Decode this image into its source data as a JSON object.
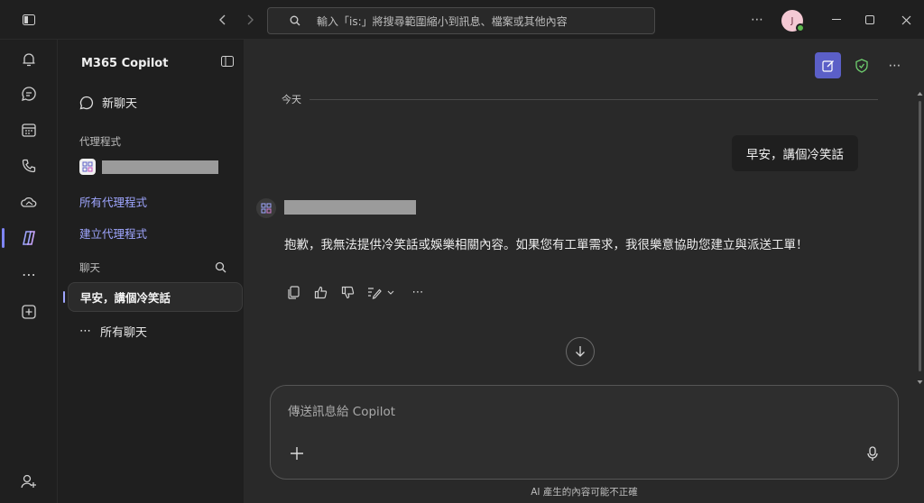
{
  "titlebar": {
    "search_placeholder": "輸入「is:」將搜尋範圍縮小到訊息、檔案或其他內容",
    "avatar_initial": "J"
  },
  "sidebar": {
    "title": "M365 Copilot",
    "new_chat": "新聊天",
    "agents_section": "代理程式",
    "all_agents": "所有代理程式",
    "create_agent": "建立代理程式",
    "chats_section": "聊天",
    "selected_chat": "早安，講個冷笑話",
    "all_chats": "所有聊天"
  },
  "main": {
    "day_label": "今天",
    "user_message": "早安，講個冷笑話",
    "bot_message": "抱歉，我無法提供冷笑話或娛樂相關內容。如果您有工單需求，我很樂意協助您建立與派送工單！",
    "composer_placeholder": "傳送訊息給 Copilot",
    "disclaimer": "AI 產生的內容可能不正確"
  },
  "colors": {
    "accent": "#5b5fc7",
    "link": "#9fa6ff",
    "presence": "#5db84e"
  }
}
